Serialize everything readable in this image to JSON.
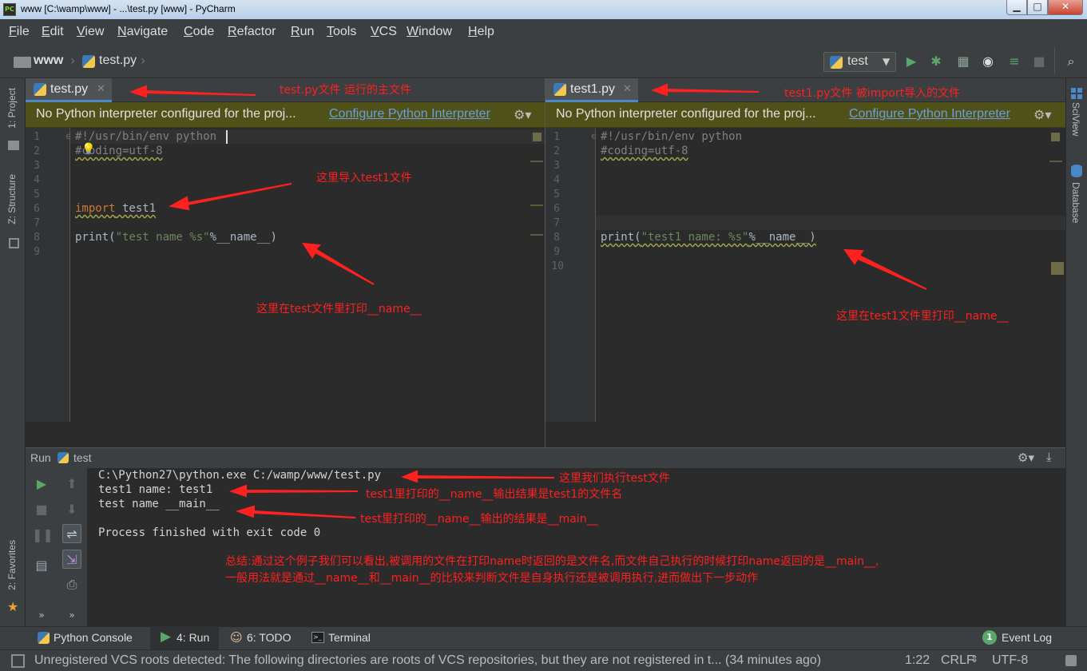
{
  "window": {
    "title": "www [C:\\wamp\\www] - ...\\test.py [www] - PyCharm",
    "minimize": "▁",
    "maximize": "□",
    "close": "✕"
  },
  "menu": [
    "File",
    "Edit",
    "View",
    "Navigate",
    "Code",
    "Refactor",
    "Run",
    "Tools",
    "VCS",
    "Window",
    "Help"
  ],
  "breadcrumb": {
    "project": "www",
    "file": "test.py"
  },
  "run_config": {
    "name": "test"
  },
  "left_tools": {
    "project": "1: Project",
    "structure": "Z: Structure",
    "favorites": "2: Favorites"
  },
  "right_tools": {
    "sciview": "SciView",
    "database": "Database"
  },
  "editor_left": {
    "tab": "test.py",
    "notice": "No Python interpreter configured for the proj...",
    "notice_link": "Configure Python Interpreter",
    "line_numbers": [
      "1",
      "2",
      "3",
      "4",
      "5",
      "6",
      "7",
      "8",
      "9"
    ],
    "code": {
      "shebang": "#!/usr/bin/env python",
      "coding": "#coding=utf-8",
      "import_kw": "import",
      "import_mod": " test1",
      "print_fn": "print(",
      "print_str": "\"test name %s\"",
      "print_rest": "%__name__)"
    }
  },
  "editor_right": {
    "tab": "test1.py",
    "notice": "No Python interpreter configured for the proj...",
    "notice_link": "Configure Python Interpreter",
    "line_numbers": [
      "1",
      "2",
      "3",
      "4",
      "5",
      "6",
      "7",
      "8",
      "9",
      "10"
    ],
    "code": {
      "shebang": "#!/usr/bin/env python",
      "coding": "#coding=utf-8",
      "print_fn": "print(",
      "print_str": "\"test1 name: %s\"",
      "print_rest": "%__name__)"
    }
  },
  "run_panel": {
    "label": "Run",
    "config": "test",
    "lines": [
      "C:\\Python27\\python.exe C:/wamp/www/test.py",
      "test1 name: test1",
      "test name __main__",
      "",
      "Process finished with exit code 0"
    ]
  },
  "bottom_tabs": {
    "python_console": "Python Console",
    "run": "4: Run",
    "todo": "6: TODO",
    "terminal": "Terminal",
    "event_log": "Event Log",
    "event_count": "1"
  },
  "status": {
    "message": "Unregistered VCS roots detected: The following directories are roots of VCS repositories, but they are not registered in t... (34 minutes ago)",
    "position": "1:22",
    "line_sep": "CRLF",
    "encoding": "UTF-8"
  },
  "annotations": {
    "a1": "test.py文件    运行的主文件",
    "a2": "test1.py文件    被import导入的文件",
    "a3": "这里导入test1文件",
    "a4": "这里在test文件里打印__name__",
    "a5": "这里在test1文件里打印__name__",
    "a6": "这里我们执行test文件",
    "a7": "test1里打印的__name__输出结果是test1的文件名",
    "a8": "test里打印的__name__输出的结果是__main__",
    "a9": "总结:通过这个例子我们可以看出,被调用的文件在打印name时返回的是文件名,而文件自己执行的时候打印name返回的是__main__,",
    "a10": "一般用法就是通过__name__和__main__的比较来判断文件是自身执行还是被调用执行,进而做出下一步动作"
  },
  "colors": {
    "accent": "#4a88c7",
    "annotation": "#ff2020",
    "run_green": "#59a869"
  }
}
